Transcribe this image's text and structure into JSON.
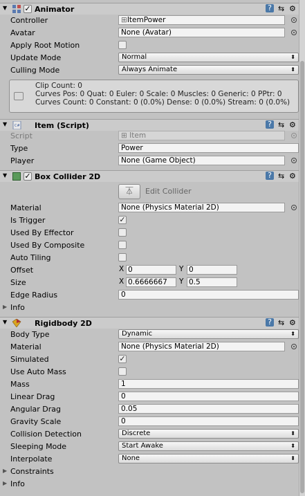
{
  "animator": {
    "title": "Animator",
    "controller_label": "Controller",
    "controller_value": "ItemPower",
    "avatar_label": "Avatar",
    "avatar_value": "None (Avatar)",
    "apply_root_motion_label": "Apply Root Motion",
    "update_mode_label": "Update Mode",
    "update_mode_value": "Normal",
    "culling_mode_label": "Culling Mode",
    "culling_mode_value": "Always Animate",
    "info_line1": "Clip Count: 0",
    "info_line2": "Curves Pos: 0 Quat: 0 Euler: 0 Scale: 0 Muscles: 0 Generic: 0 PPtr: 0",
    "info_line3": "Curves Count: 0 Constant: 0 (0.0%) Dense: 0 (0.0%) Stream: 0 (0.0%)"
  },
  "item_script": {
    "title": "Item (Script)",
    "script_label": "Script",
    "script_value": "Item",
    "type_label": "Type",
    "type_value": "Power",
    "player_label": "Player",
    "player_value": "None (Game Object)"
  },
  "box_collider": {
    "title": "Box Collider 2D",
    "edit_collider": "Edit Collider",
    "material_label": "Material",
    "material_value": "None (Physics Material 2D)",
    "is_trigger_label": "Is Trigger",
    "used_by_effector_label": "Used By Effector",
    "used_by_composite_label": "Used By Composite",
    "auto_tiling_label": "Auto Tiling",
    "offset_label": "Offset",
    "offset_x": "0",
    "offset_y": "0",
    "size_label": "Size",
    "size_x": "0.6666667",
    "size_y": "0.5",
    "edge_radius_label": "Edge Radius",
    "edge_radius_value": "0",
    "info_label": "Info",
    "x_label": "X",
    "y_label": "Y"
  },
  "rigidbody": {
    "title": "Rigidbody 2D",
    "body_type_label": "Body Type",
    "body_type_value": "Dynamic",
    "material_label": "Material",
    "material_value": "None (Physics Material 2D)",
    "simulated_label": "Simulated",
    "use_auto_mass_label": "Use Auto Mass",
    "mass_label": "Mass",
    "mass_value": "1",
    "linear_drag_label": "Linear Drag",
    "linear_drag_value": "0",
    "angular_drag_label": "Angular Drag",
    "angular_drag_value": "0.05",
    "gravity_scale_label": "Gravity Scale",
    "gravity_scale_value": "0",
    "collision_detection_label": "Collision Detection",
    "collision_detection_value": "Discrete",
    "sleeping_mode_label": "Sleeping Mode",
    "sleeping_mode_value": "Start Awake",
    "interpolate_label": "Interpolate",
    "interpolate_value": "None",
    "constraints_label": "Constraints",
    "info_label": "Info"
  },
  "checkbox_states": {
    "animator_enabled": true,
    "apply_root_motion": false,
    "box_collider_enabled": true,
    "is_trigger": true,
    "used_by_effector": false,
    "used_by_composite": false,
    "auto_tiling": false,
    "simulated": true,
    "use_auto_mass": false
  },
  "glyphs": {
    "check": "✓",
    "fold_open": "▼",
    "fold_closed": "▶",
    "dropdown": "⬍",
    "tune": "⇆",
    "gear": "⚙",
    "book": "?",
    "ref": "⊞",
    "edit": "⏄"
  },
  "colors": {
    "background": "#c2c2c2",
    "header": "#cbcbcb",
    "help_icon": "#4a78a8"
  }
}
